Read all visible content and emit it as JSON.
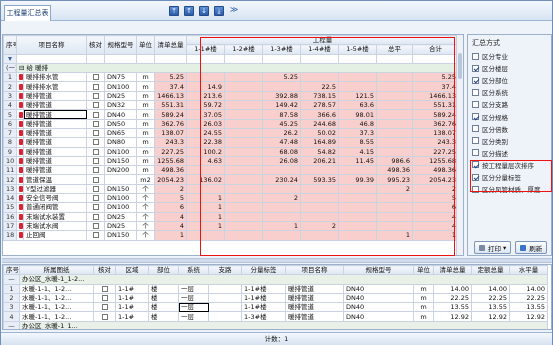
{
  "window": {
    "tab_label": "工程量汇总表",
    "status_text": "计数：1"
  },
  "toolbar": {
    "buttons": [
      {
        "name": "move-top-button",
        "glyph": "⤒"
      },
      {
        "name": "move-up-button",
        "glyph": "↑"
      },
      {
        "name": "move-down-button",
        "glyph": "↓"
      },
      {
        "name": "move-bottom-button",
        "glyph": "⤓"
      },
      {
        "name": "collapse-button",
        "glyph": "≫"
      }
    ]
  },
  "upper": {
    "quantity_group_label": "工程量",
    "headers": {
      "seq": "序号",
      "item": "项目名称",
      "check": "核对",
      "spec": "规格型号",
      "unit": "单位",
      "total_qty": "清单总量",
      "b1": "1-1#楼",
      "b2": "1-2#楼",
      "b3": "1-3#楼",
      "b4": "1-4#楼",
      "b5": "1-5#楼",
      "zp": "总平",
      "sum": "合计"
    },
    "filter_row_label": "",
    "group_row": {
      "seq": "(一)",
      "label": "给 暖排"
    },
    "rows": [
      {
        "n": "1",
        "item": "暖排排水管",
        "spec": "DN75",
        "unit": "m",
        "total": "5.25",
        "b1": "",
        "b2": "",
        "b3": "5.25",
        "b4": "",
        "b5": "",
        "zp": "",
        "sum": "5.25"
      },
      {
        "n": "2",
        "item": "暖排排水管",
        "spec": "DN100",
        "unit": "m",
        "total": "37.4",
        "b1": "14.9",
        "b2": "",
        "b3": "",
        "b4": "22.5",
        "b5": "",
        "zp": "",
        "sum": "37.4"
      },
      {
        "n": "3",
        "item": "暖排管道",
        "spec": "DN25",
        "unit": "m",
        "total": "1466.13",
        "b1": "213.6",
        "b2": "",
        "b3": "392.88",
        "b4": "738.15",
        "b5": "121.5",
        "zp": "",
        "sum": "1466.13"
      },
      {
        "n": "4",
        "item": "暖排管道",
        "spec": "DN32",
        "unit": "m",
        "total": "551.31",
        "b1": "59.72",
        "b2": "",
        "b3": "149.42",
        "b4": "278.57",
        "b5": "63.6",
        "zp": "",
        "sum": "551.31"
      },
      {
        "n": "5",
        "item": "暖排管道",
        "spec": "DN40",
        "unit": "m",
        "total": "589.24",
        "b1": "37.05",
        "b2": "",
        "b3": "87.58",
        "b4": "366.6",
        "b5": "98.01",
        "zp": "",
        "sum": "589.24"
      },
      {
        "n": "6",
        "item": "暖排管道",
        "spec": "DN50",
        "unit": "m",
        "total": "362.76",
        "b1": "26.03",
        "b2": "",
        "b3": "45.25",
        "b4": "244.68",
        "b5": "46.8",
        "zp": "",
        "sum": "362.76"
      },
      {
        "n": "7",
        "item": "暖排管道",
        "spec": "DN65",
        "unit": "m",
        "total": "138.07",
        "b1": "24.55",
        "b2": "",
        "b3": "26.2",
        "b4": "50.02",
        "b5": "37.3",
        "zp": "",
        "sum": "138.07"
      },
      {
        "n": "8",
        "item": "暖排管道",
        "spec": "DN80",
        "unit": "m",
        "total": "243.3",
        "b1": "22.38",
        "b2": "",
        "b3": "47.48",
        "b4": "164.89",
        "b5": "8.55",
        "zp": "",
        "sum": "243.3"
      },
      {
        "n": "9",
        "item": "暖排管道",
        "spec": "DN100",
        "unit": "m",
        "total": "227.25",
        "b1": "100.2",
        "b2": "",
        "b3": "68.08",
        "b4": "54.82",
        "b5": "4.15",
        "zp": "",
        "sum": "227.25"
      },
      {
        "n": "10",
        "item": "暖排管道",
        "spec": "DN150",
        "unit": "m",
        "total": "1255.68",
        "b1": "4.63",
        "b2": "",
        "b3": "26.08",
        "b4": "206.21",
        "b5": "11.45",
        "zp": "986.6",
        "sum": "1255.68"
      },
      {
        "n": "11",
        "item": "暖排管道",
        "spec": "DN200",
        "unit": "m",
        "total": "498.36",
        "b1": "",
        "b2": "",
        "b3": "",
        "b4": "",
        "b5": "",
        "zp": "498.36",
        "sum": "498.36"
      },
      {
        "n": "12",
        "item": "管道保温",
        "spec": "",
        "unit": "m2",
        "total": "2054.23",
        "b1": "136.02",
        "b2": "",
        "b3": "230.24",
        "b4": "593.35",
        "b5": "99.39",
        "zp": "995.23",
        "sum": "2054.23"
      },
      {
        "n": "13",
        "item": "Y型过滤器",
        "spec": "DN150",
        "unit": "个",
        "total": "2",
        "b1": "",
        "b2": "",
        "b3": "",
        "b4": "",
        "b5": "",
        "zp": "2",
        "sum": "2"
      },
      {
        "n": "14",
        "item": "安全信号阀",
        "spec": "DN100",
        "unit": "个",
        "total": "5",
        "b1": "1",
        "b2": "",
        "b3": "2",
        "b4": "",
        "b5": "",
        "zp": "",
        "sum": "5"
      },
      {
        "n": "15",
        "item": "普通闭阀管",
        "spec": "DN100",
        "unit": "个",
        "total": "6",
        "b1": "1",
        "b2": "",
        "b3": "",
        "b4": "",
        "b5": "",
        "zp": "",
        "sum": "6"
      },
      {
        "n": "16",
        "item": "末端试水装置",
        "spec": "DN25",
        "unit": "个",
        "total": "4",
        "b1": "1",
        "b2": "",
        "b3": "",
        "b4": "",
        "b5": "",
        "zp": "",
        "sum": "4"
      },
      {
        "n": "17",
        "item": "末端试水阀",
        "spec": "DN25",
        "unit": "个",
        "total": "4",
        "b1": "1",
        "b2": "",
        "b3": "1",
        "b4": "2",
        "b5": "",
        "zp": "",
        "sum": "4"
      },
      {
        "n": "18",
        "item": "止回阀",
        "spec": "DN150",
        "unit": "个",
        "total": "1",
        "b1": "",
        "b2": "",
        "b3": "",
        "b4": "",
        "b5": "",
        "zp": "1",
        "sum": "1"
      }
    ]
  },
  "side": {
    "header": "汇总方式",
    "options": [
      {
        "label": "区分专业",
        "on": false
      },
      {
        "label": "区分楼层",
        "on": true
      },
      {
        "label": "区分部位",
        "on": true
      },
      {
        "label": "区分系统",
        "on": false
      },
      {
        "label": "区分支路",
        "on": false
      },
      {
        "label": "区分规格",
        "on": true
      },
      {
        "label": "区分倍数",
        "on": false
      },
      {
        "label": "区分类别",
        "on": false
      },
      {
        "label": "区分描述",
        "on": false
      },
      {
        "label": "按工程量层次排序",
        "on": true
      },
      {
        "label": "区分分量标签",
        "on": true
      },
      {
        "label": "区分风管材质、厚度",
        "on": false
      }
    ],
    "print_label": "打印",
    "refresh_label": "刷新"
  },
  "lower": {
    "headers": {
      "seq": "序号",
      "drawing": "所属图纸",
      "check": "核对",
      "area": "区域",
      "part": "部位",
      "system": "系统",
      "branch": "支路",
      "tag": "分量标签",
      "item": "项目名称",
      "spec": "规格型号",
      "unit": "单位",
      "qty": "清单总量",
      "fixed": "定额总量",
      "lvl": "水平量"
    },
    "group_row": {
      "seq": "—",
      "drawing": "办公区_水暖-1_1-2..."
    },
    "rows": [
      {
        "n": "1",
        "drawing": "水暖-1-1、1-2...",
        "area": "1-1#",
        "part": "楼",
        "system": "一层",
        "branch": "",
        "tag": "1-1#楼",
        "item": "暖排管道",
        "spec": "DN40",
        "unit": "m",
        "qty": "14.00",
        "fixed": "14.00",
        "lvl": "14.00"
      },
      {
        "n": "2",
        "drawing": "水暖-1-1、1-2...",
        "area": "1-1#",
        "part": "楼",
        "system": "一层",
        "branch": "",
        "tag": "1-1#楼",
        "item": "暖排管道",
        "spec": "DN40",
        "unit": "m",
        "qty": "22.25",
        "fixed": "22.25",
        "lvl": "22.25"
      },
      {
        "n": "3",
        "drawing": "水暖-1-1、1-2...",
        "area": "1-1#",
        "part": "楼",
        "system": "一层",
        "branch": "",
        "tag": "1-1#楼",
        "item": "暖排管道",
        "spec": "DN40",
        "unit": "m",
        "qty": "13.55",
        "fixed": "13.55",
        "lvl": "13.55"
      },
      {
        "n": "4",
        "drawing": "水暖-1-1、1-2...",
        "area": "1-1#",
        "part": "楼",
        "system": "一层",
        "branch": "",
        "tag": "1-3#楼",
        "item": "暖排管道",
        "spec": "DN40",
        "unit": "m",
        "qty": "12.92",
        "fixed": "12.92",
        "lvl": "12.92"
      }
    ],
    "tail_group": {
      "seq": "—",
      "drawing": "办公区_水暖-1_1..."
    }
  }
}
